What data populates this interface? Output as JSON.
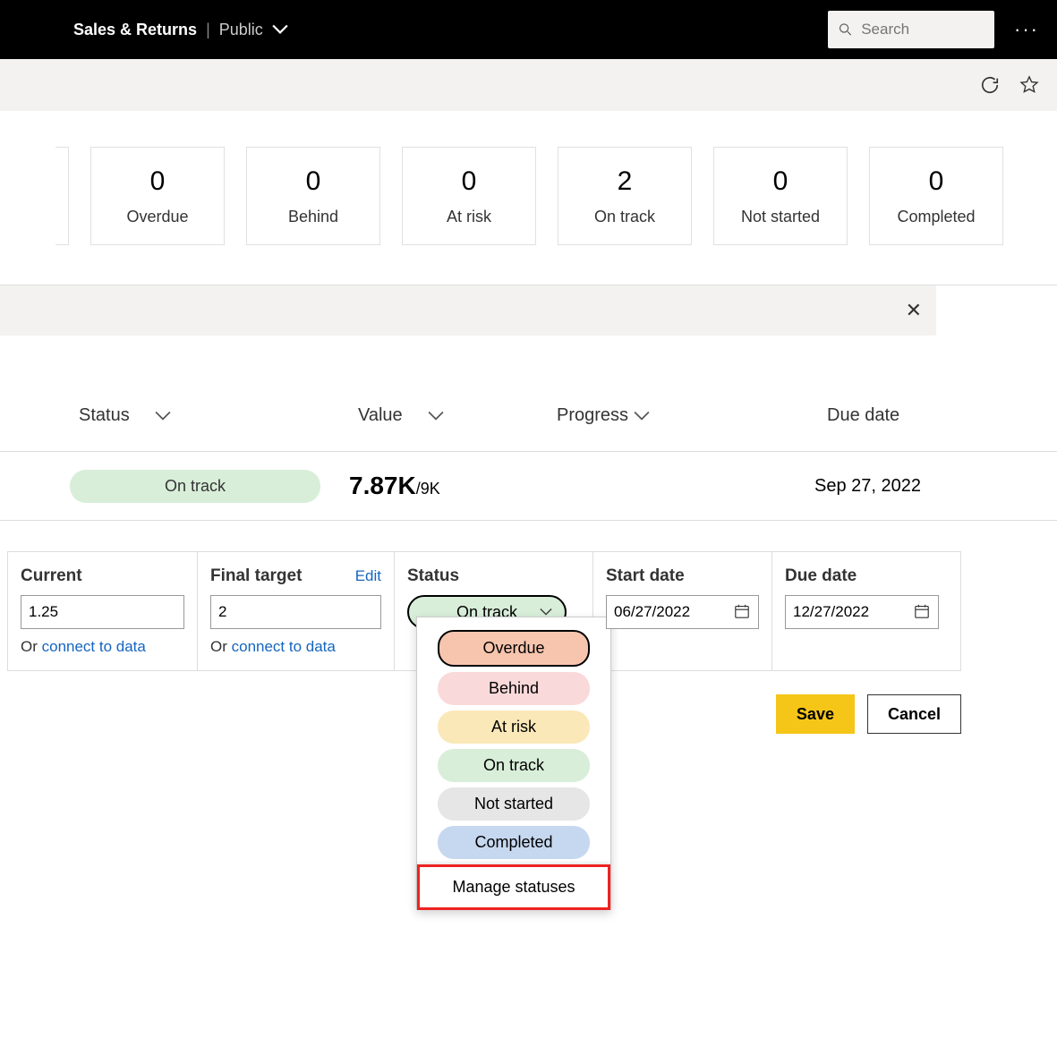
{
  "header": {
    "title": "Sales & Returns",
    "subtitle": "Public",
    "search_placeholder": "Search"
  },
  "tiles": [
    {
      "count": "0",
      "label": "Overdue"
    },
    {
      "count": "0",
      "label": "Behind"
    },
    {
      "count": "0",
      "label": "At risk"
    },
    {
      "count": "2",
      "label": "On track"
    },
    {
      "count": "0",
      "label": "Not started"
    },
    {
      "count": "0",
      "label": "Completed"
    }
  ],
  "columns": {
    "status": "Status",
    "value": "Value",
    "progress": "Progress",
    "due_date": "Due date"
  },
  "summary": {
    "status_label": "On track",
    "value_main": "7.87K",
    "value_denom": "/9K",
    "due_date": "Sep 27, 2022"
  },
  "edit": {
    "current_label": "Current",
    "current_value": "1.25",
    "final_target_label": "Final target",
    "final_target_value": "2",
    "edit_link": "Edit",
    "or_prefix": "Or ",
    "connect_link": "connect to data",
    "status_label": "Status",
    "status_value": "On track",
    "start_date_label": "Start date",
    "start_date_value": "06/27/2022",
    "due_date_label": "Due date",
    "due_date_value": "12/27/2022"
  },
  "dropdown": {
    "overdue": "Overdue",
    "behind": "Behind",
    "at_risk": "At risk",
    "on_track": "On track",
    "not_started": "Not started",
    "completed": "Completed",
    "manage": "Manage statuses"
  },
  "buttons": {
    "save": "Save",
    "cancel": "Cancel"
  }
}
